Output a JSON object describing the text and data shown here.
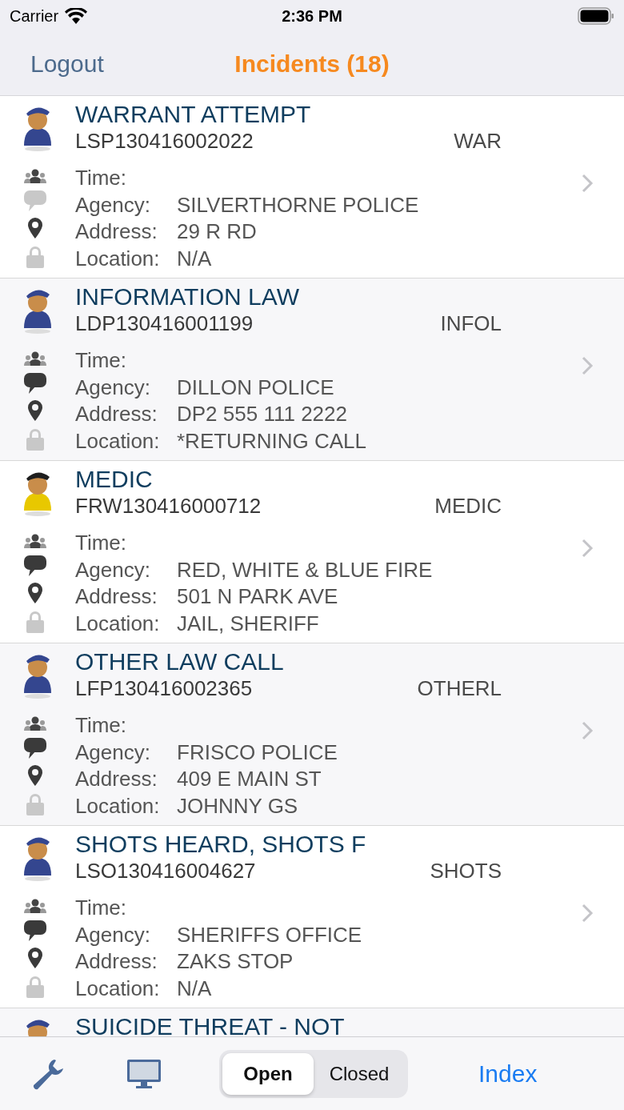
{
  "status_bar": {
    "carrier": "Carrier",
    "time": "2:36 PM"
  },
  "nav": {
    "left": "Logout",
    "title": "Incidents (18)"
  },
  "incidents": [
    {
      "kind": "police",
      "title": "WARRANT ATTEMPT",
      "number": "LSP130416002022",
      "code": "WAR",
      "has_comments": false,
      "fields": [
        {
          "label": "Time:"
        },
        {
          "label": "Agency:",
          "value": "SILVERTHORNE POLICE"
        },
        {
          "label": "Address:",
          "value": "29 R RD"
        },
        {
          "label": "Location:",
          "value": "N/A"
        }
      ]
    },
    {
      "kind": "police",
      "title": "INFORMATION LAW",
      "number": "LDP130416001199",
      "code": "INFOL",
      "has_comments": true,
      "fields": [
        {
          "label": "Time:"
        },
        {
          "label": "Agency:",
          "value": "DILLON POLICE"
        },
        {
          "label": "Address:",
          "value": "DP2 555 111 2222"
        },
        {
          "label": "Location:",
          "value": "*RETURNING CALL"
        }
      ]
    },
    {
      "kind": "fire",
      "title": "MEDIC",
      "number": "FRW130416000712",
      "code": "MEDIC",
      "has_comments": true,
      "fields": [
        {
          "label": "Time:"
        },
        {
          "label": "Agency:",
          "value": "RED, WHITE & BLUE FIRE"
        },
        {
          "label": "Address:",
          "value": "501 N PARK AVE"
        },
        {
          "label": "Location:",
          "value": "JAIL, SHERIFF"
        }
      ]
    },
    {
      "kind": "police",
      "title": "OTHER LAW CALL",
      "number": "LFP130416002365",
      "code": "OTHERL",
      "has_comments": true,
      "fields": [
        {
          "label": "Time:"
        },
        {
          "label": "Agency:",
          "value": "FRISCO POLICE"
        },
        {
          "label": "Address:",
          "value": "409 E MAIN ST"
        },
        {
          "label": "Location:",
          "value": "JOHNNY GS"
        }
      ]
    },
    {
      "kind": "police",
      "title": "SHOTS HEARD, SHOTS F",
      "number": "LSO130416004627",
      "code": "SHOTS",
      "has_comments": true,
      "fields": [
        {
          "label": "Time:"
        },
        {
          "label": "Agency:",
          "value": "SHERIFFS OFFICE"
        },
        {
          "label": "Address:",
          "value": "ZAKS STOP"
        },
        {
          "label": "Location:",
          "value": "N/A"
        }
      ]
    },
    {
      "kind": "police",
      "title": "SUICIDE THREAT - NOT"
    }
  ],
  "segments": [
    {
      "label": "Open",
      "selected": true
    },
    {
      "label": "Closed",
      "selected": false
    }
  ],
  "index_button": "Index"
}
